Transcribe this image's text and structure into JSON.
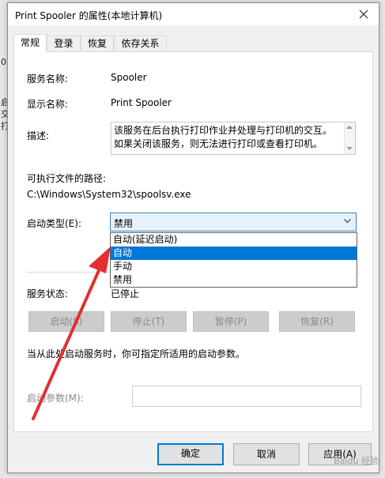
{
  "window": {
    "title": "Print Spooler 的属性(本地计算机)"
  },
  "tabs": [
    {
      "label": "常规"
    },
    {
      "label": "登录"
    },
    {
      "label": "恢复"
    },
    {
      "label": "依存关系"
    }
  ],
  "general": {
    "service_name_label": "服务名称:",
    "service_name_value": "Spooler",
    "display_name_label": "显示名称:",
    "display_name_value": "Print Spooler",
    "description_label": "描述:",
    "description_value": "该服务在后台执行打印作业并处理与打印机的交互。如果关闭该服务，则无法进行打印或查看打印机。",
    "path_label": "可执行文件的路径:",
    "path_value": "C:\\Windows\\System32\\spoolsv.exe",
    "startup_type_label": "启动类型(E):",
    "startup_type_value": "禁用",
    "startup_options": [
      "自动(延迟启动)",
      "自动",
      "手动",
      "禁用"
    ],
    "highlighted_option": "自动",
    "service_status_label": "服务状态:",
    "service_status_value": "已停止",
    "buttons": {
      "start": "启动(S)",
      "stop": "停止(T)",
      "pause": "暂停(P)",
      "resume": "恢复(R)"
    },
    "hint": "当从此处启动服务时，你可指定所适用的启动参数。",
    "start_params_label": "启动参数(M):",
    "start_params_value": ""
  },
  "footer": {
    "ok": "确定",
    "cancel": "取消",
    "apply": "应用(A)"
  },
  "annotation": {
    "arrow_color": "#e03030"
  }
}
